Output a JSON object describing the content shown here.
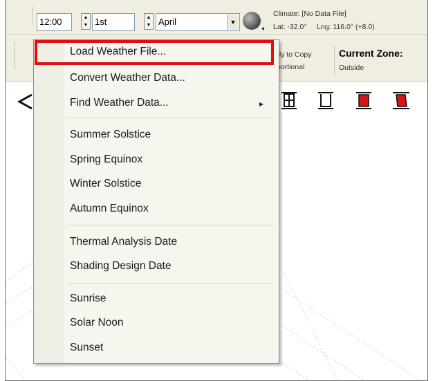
{
  "toolbar": {
    "time_value": "12:00",
    "day_value": "1st",
    "month_value": "April",
    "climate_label": "Climate: [No Data File]",
    "lat_label": "Lat: -32.0°",
    "lng_label": "Lng: 116.0° (+8.0)",
    "apply_copy_text": "ply to Copy",
    "proportional_text": "portional",
    "current_zone_label": "Current Zone:",
    "current_zone_value": "Outside"
  },
  "menu": {
    "items": [
      {
        "label": "Load Weather File..."
      },
      {
        "label": "Convert Weather Data..."
      },
      {
        "label": "Find Weather Data..."
      },
      {
        "label": "Summer Solstice"
      },
      {
        "label": "Spring Equinox"
      },
      {
        "label": "Winter Solstice"
      },
      {
        "label": "Autumn Equinox"
      },
      {
        "label": "Thermal Analysis Date"
      },
      {
        "label": "Shading Design Date"
      },
      {
        "label": "Sunrise"
      },
      {
        "label": "Solar Noon"
      },
      {
        "label": "Sunset"
      }
    ]
  },
  "colors": {
    "highlight_border": "#e01010",
    "toolbar_bg": "#f0ede1",
    "menu_bg": "#f7f6ee",
    "zone_icon_red": "#d81418"
  }
}
